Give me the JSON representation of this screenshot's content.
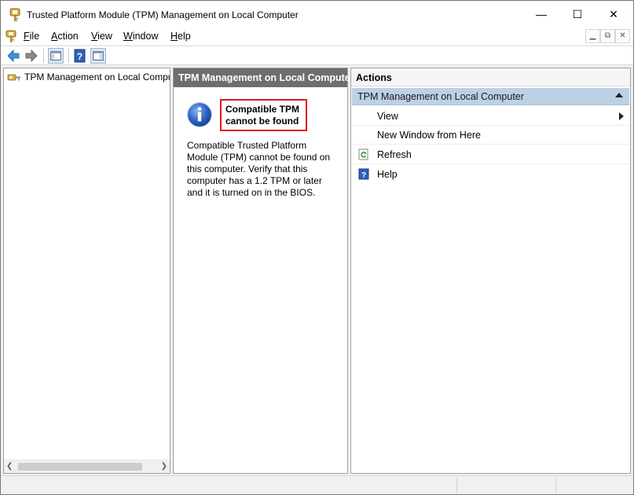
{
  "window": {
    "title": "Trusted Platform Module (TPM) Management on Local Computer",
    "minimize_glyph": "—",
    "maximize_glyph": "☐",
    "close_glyph": "✕"
  },
  "menu": {
    "items": [
      {
        "accel": "F",
        "rest": "ile"
      },
      {
        "accel": "A",
        "rest": "ction"
      },
      {
        "accel": "V",
        "rest": "iew"
      },
      {
        "accel": "W",
        "rest": "indow"
      },
      {
        "accel": "H",
        "rest": "elp"
      }
    ]
  },
  "toolbar": {
    "icons": [
      "back-arrow-icon",
      "forward-arrow-icon",
      "show-hide-console-tree-icon",
      "help-icon",
      "show-hide-action-pane-icon"
    ]
  },
  "tree": {
    "root_label": "TPM Management on Local Computer"
  },
  "center": {
    "header": "TPM Management on Local Computer",
    "alert_title": "Compatible TPM cannot be found",
    "description": "Compatible Trusted Platform Module (TPM) cannot be found on this computer. Verify that this computer has a 1.2 TPM or later and it is turned on in the BIOS."
  },
  "actions": {
    "header": "Actions",
    "section_title": "TPM Management on Local Computer",
    "items": [
      {
        "label": "View",
        "icon": "",
        "has_submenu": true
      },
      {
        "label": "New Window from Here",
        "icon": "",
        "has_submenu": false
      },
      {
        "label": "Refresh",
        "icon": "refresh-icon",
        "has_submenu": false
      },
      {
        "label": "Help",
        "icon": "help-icon",
        "has_submenu": false
      }
    ]
  },
  "colors": {
    "alert_border": "#e0181b",
    "section_highlight": "#bcd0e6",
    "center_header_bg": "#6e6e6e"
  }
}
